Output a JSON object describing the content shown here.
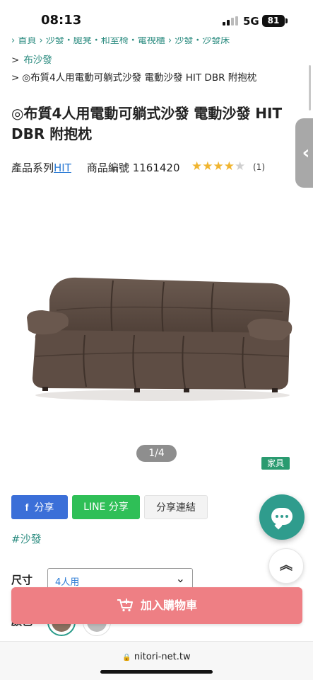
{
  "status_bar": {
    "time": "08:13",
    "network": "5G",
    "battery": "81"
  },
  "breadcrumb": {
    "top_partial": "› 首頁 › 沙發・腿凳・和室椅・電視櫃 › 沙發・沙發床",
    "items": [
      {
        "sep": ">",
        "label": "布沙發"
      },
      {
        "sep": ">",
        "label": "◎布質4人用電動可躺式沙發 電動沙發 HIT DBR 附抱枕"
      }
    ]
  },
  "product": {
    "title": "◎布質4人用電動可躺式沙發 電動沙發 HIT DBR 附抱枕",
    "series_label": "產品系列",
    "series_value": "HIT",
    "code_label": "商品編號",
    "code_value": "1161420",
    "rating": 4,
    "review_count": "(1)",
    "slide_counter": "1/4",
    "category_badge": "家具",
    "sofa_color": "#5b4a40"
  },
  "share": {
    "facebook_icon": "f",
    "facebook_label": "分享",
    "line_label": "LINE 分享",
    "copy_link_label": "分享連結"
  },
  "tag": "#沙發",
  "options": {
    "size_label": "尺寸",
    "size_value": "4人用",
    "color_label": "顏色",
    "swatches": [
      "#8a7060",
      "#bdbdbd"
    ]
  },
  "cart": {
    "label": "加入購物車",
    "color": "#ee7f84"
  },
  "browser": {
    "url": "nitori-net.tw"
  },
  "side_tab": {
    "glyph": "‹"
  },
  "fab": {
    "top_glyph": "︽"
  }
}
